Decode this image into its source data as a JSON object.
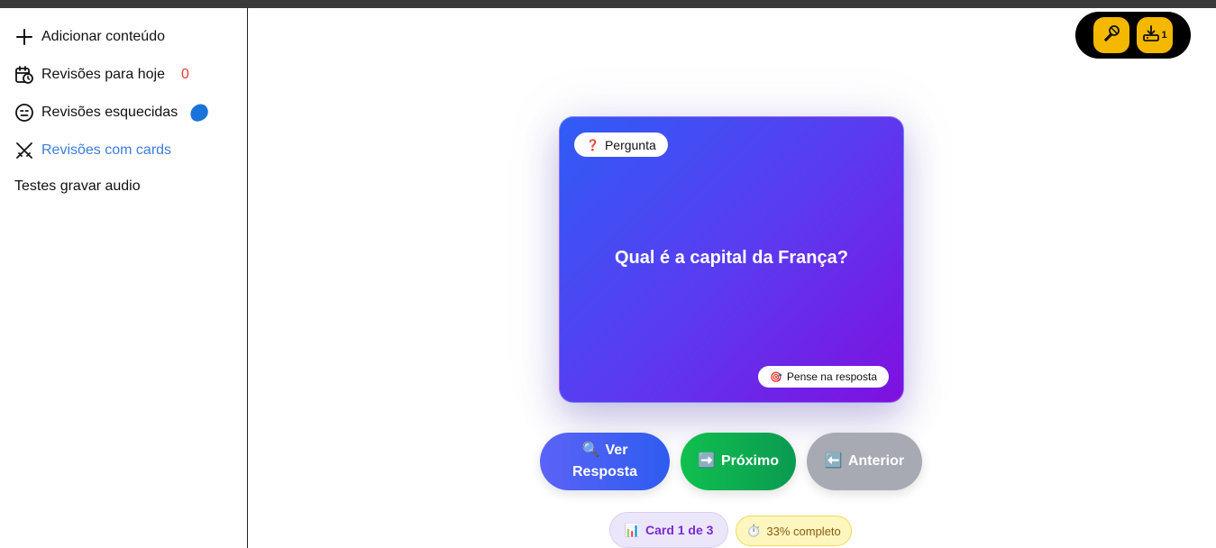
{
  "sidebar": {
    "items": [
      {
        "label": "Adicionar conteúdo",
        "icon": "plus-icon"
      },
      {
        "label": "Revisões para hoje",
        "icon": "calendar-clock-icon",
        "badge": "0"
      },
      {
        "label": "Revisões esquecidas",
        "icon": "neutral-face-icon"
      },
      {
        "label": "Revisões com cards",
        "icon": "crossed-swords-icon"
      },
      {
        "label": "Testes gravar audio"
      }
    ]
  },
  "toolbar": {
    "mic_icon": "microphone-icon",
    "download_icon": "download-tray-icon",
    "download_count": "1"
  },
  "card": {
    "badge_emoji": "❓",
    "badge_label": "Pergunta",
    "question": "Qual é a capital da França?",
    "hint_emoji": "🎯",
    "hint_label": "Pense na resposta"
  },
  "buttons": {
    "show_emoji": "🔍",
    "show_label_1": "Ver",
    "show_label_2": "Resposta",
    "next_emoji": "➡️",
    "next_label": "Próximo",
    "prev_emoji": "⬅️",
    "prev_label": "Anterior"
  },
  "status": {
    "card_emoji": "📊",
    "card_label": "Card 1 de 3",
    "progress_emoji": "⏱️",
    "progress_label": "33% completo",
    "progress_fraction": 0.33
  },
  "colors": {
    "active_link": "#3b7ddd",
    "badge_red": "#e53935",
    "tool_yellow": "#f5b800",
    "next_green": "#10c04e"
  }
}
